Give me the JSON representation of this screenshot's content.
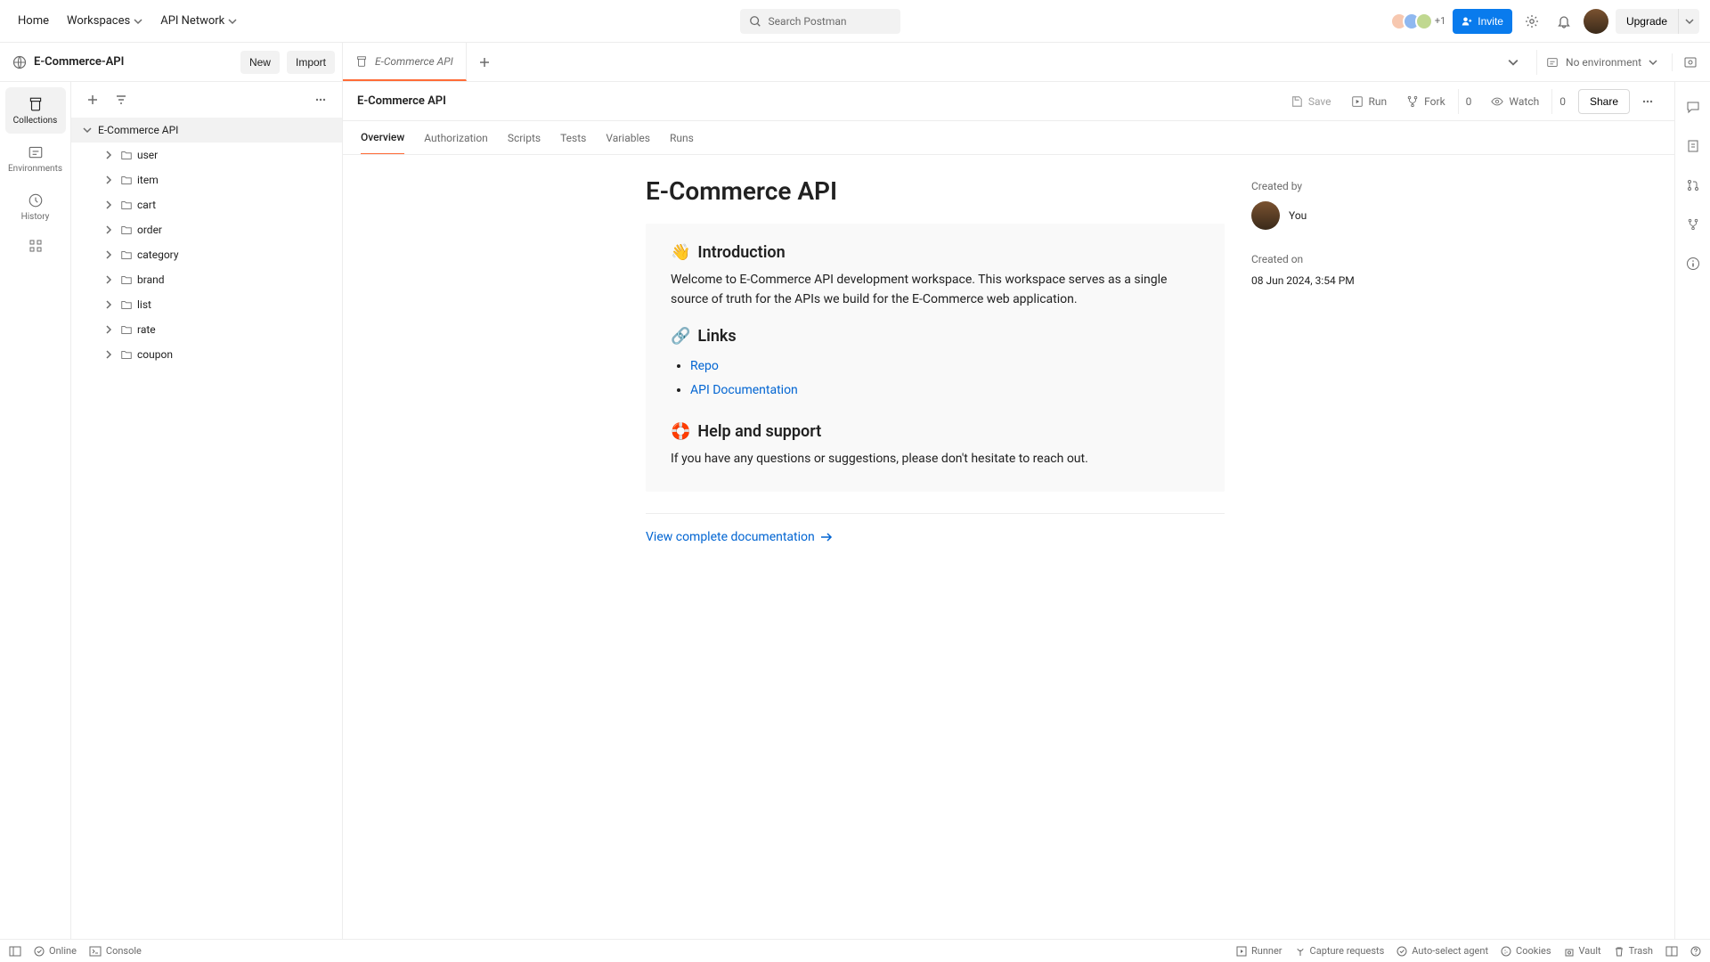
{
  "header": {
    "home": "Home",
    "workspaces": "Workspaces",
    "apiNetwork": "API Network",
    "searchPlaceholder": "Search Postman",
    "moreAvatars": "+1",
    "invite": "Invite",
    "upgrade": "Upgrade"
  },
  "workspace": {
    "name": "E-Commerce-API",
    "new": "New",
    "import": "Import",
    "tabLabel": "E-Commerce API",
    "noEnv": "No environment"
  },
  "rail": {
    "collections": "Collections",
    "environments": "Environments",
    "history": "History"
  },
  "tree": {
    "root": "E-Commerce API",
    "items": [
      "user",
      "item",
      "cart",
      "order",
      "category",
      "brand",
      "list",
      "rate",
      "coupon"
    ]
  },
  "crumb": {
    "title": "E-Commerce API",
    "save": "Save",
    "run": "Run",
    "fork": "Fork",
    "forkCount": "0",
    "watch": "Watch",
    "watchCount": "0",
    "share": "Share"
  },
  "ctabs": [
    "Overview",
    "Authorization",
    "Scripts",
    "Tests",
    "Variables",
    "Runs"
  ],
  "doc": {
    "title": "E-Commerce API",
    "introHead": "Introduction",
    "introBody": "Welcome to E-Commerce API development workspace. This workspace serves as a single source of truth for the APIs we build for the E-Commerce web application.",
    "linksHead": "Links",
    "link1": "Repo",
    "link2": "API Documentation",
    "helpHead": "Help and support",
    "helpBody": "If you have any questions or suggestions, please don't hesitate to reach out.",
    "viewDocs": "View complete documentation"
  },
  "meta": {
    "createdByLabel": "Created by",
    "createdByName": "You",
    "createdOnLabel": "Created on",
    "createdOnValue": "08 Jun 2024, 3:54 PM"
  },
  "footer": {
    "online": "Online",
    "console": "Console",
    "runner": "Runner",
    "capture": "Capture requests",
    "agent": "Auto-select agent",
    "cookies": "Cookies",
    "vault": "Vault",
    "trash": "Trash"
  }
}
